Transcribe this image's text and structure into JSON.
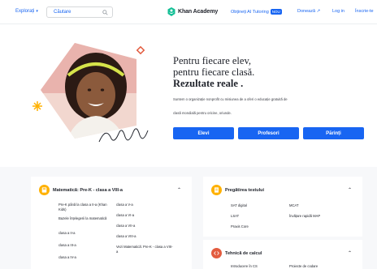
{
  "header": {
    "explore_label": "Explorați",
    "search_placeholder": "Căutare",
    "logo_name": "Khan Academy",
    "tutor_label": "Obțineți AI Tutoring",
    "tutor_badge": "NOU",
    "donate_label": "Donează",
    "login_label": "Log in",
    "signup_label": "Înscrie-te"
  },
  "hero": {
    "title_line1": "Pentru fiecare elev,",
    "title_line2": "pentru fiecare clasă.",
    "title_line3": "Rezultate reale .",
    "desc_1": "Suntem o organizație nonprofit cu misiunea de a oferi o educație gratuită de",
    "desc_2": "clasă mondială pentru oricine, oriunde.",
    "buttons": [
      "Elevi",
      "Profesori",
      "Părinți"
    ]
  },
  "courses": {
    "math": {
      "title": "Matematică: Pre-K - clasa a VIII-a",
      "col1": [
        "Pre-K până la clasa a II-a (Khan Kids)",
        "Bazele înțelegerii la matematică",
        "clasa a II-a",
        "clasa a III-a",
        "clasa a IV-a"
      ],
      "col2": [
        "clasa a V-a",
        "clasa a VI-a",
        "clasa a VII-a",
        "clasa a VIII-a",
        "Vezi Matematică: Pre-K - clasa a VIII-a"
      ]
    },
    "test_prep": {
      "title": "Pregătirea testului",
      "col1": [
        "SAT digital",
        "LSAT",
        "Praxis Core"
      ],
      "col2": [
        "MCAT",
        "Învățare rapidă MAP"
      ]
    },
    "computing": {
      "title": "Tehnică de calcul",
      "col1": [
        "Introducere în CS"
      ],
      "col2": [
        "Proiecte de codare"
      ]
    }
  },
  "colors": {
    "brand_blue": "#1865f2",
    "logo_green": "#14bf96",
    "hero_bg_pink": "#e9b3ad",
    "math_icon": "#ffb100",
    "test_icon": "#ffb100",
    "computing_icon": "#e35c3f"
  },
  "icons": {
    "search": "search-icon",
    "logo": "khan-leaf-icon",
    "donate": "external-link-icon",
    "math": "calculator-icon",
    "test": "test-paper-icon",
    "computing": "code-icon"
  }
}
